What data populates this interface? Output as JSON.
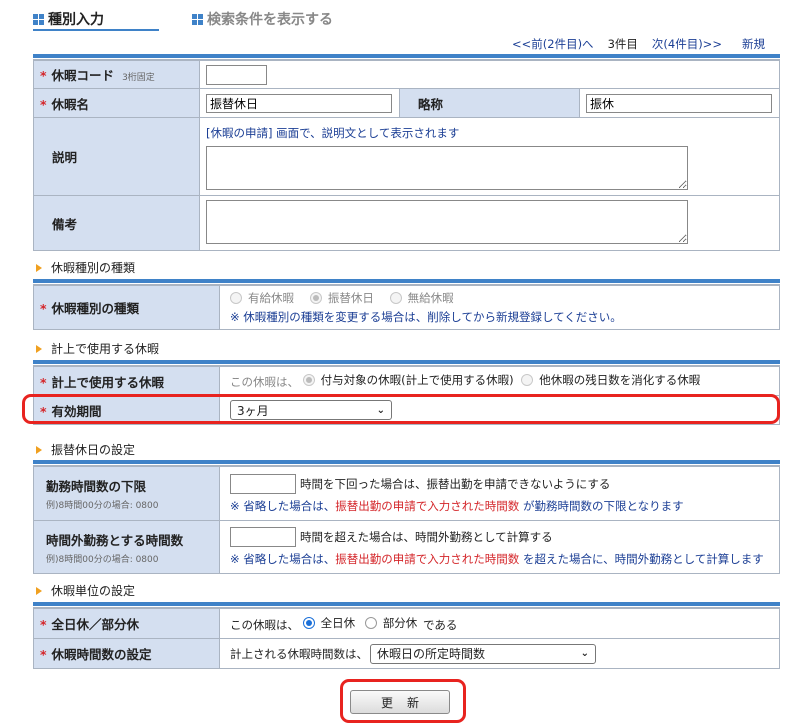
{
  "tabs": {
    "active": "種別入力",
    "inactive": "検索条件を表示する"
  },
  "pager": {
    "prev": "<<前(2件目)へ",
    "current": "3件目",
    "next": "次(4件目)>>",
    "new": "新規"
  },
  "fields": {
    "code": {
      "label": "休暇コード",
      "hint": "3桁固定",
      "value": ""
    },
    "name": {
      "label": "休暇名",
      "value": "振替休日"
    },
    "abbr": {
      "label": "略称",
      "value": "振休"
    },
    "desc": {
      "label": "説明",
      "note_link": "[休暇の申請]",
      "note_rest": "画面で、説明文として表示されます",
      "value": ""
    },
    "remarks": {
      "label": "備考",
      "value": ""
    }
  },
  "sections": {
    "kind": "休暇種別の種類",
    "plan": "計上で使用する休暇",
    "subst": "振替休日の設定",
    "unit": "休暇単位の設定"
  },
  "kind": {
    "label": "休暇種別の種類",
    "options": [
      "有給休暇",
      "振替休日",
      "無給休暇"
    ],
    "note": "※ 休暇種別の種類を変更する場合は、削除してから新規登録してください。"
  },
  "plan": {
    "label": "計上で使用する休暇",
    "prefix": "この休暇は、",
    "opt1": "付与対象の休暇(計上で使用する休暇)",
    "opt2": "他休暇の残日数を消化する休暇"
  },
  "validity": {
    "label": "有効期間",
    "value": "3ヶ月"
  },
  "subst": {
    "lower": {
      "label": "勤務時間数の下限",
      "example": "例)8時間00分の場合: 0800",
      "text": "時間を下回った場合は、振替出勤を申請できないようにする",
      "note_a": "※ 省略した場合は、",
      "note_red": "振替出勤の申請で入力された時間数",
      "note_b": "が勤務時間数の下限となります"
    },
    "overtime": {
      "label": "時間外勤務とする時間数",
      "example": "例)8時間00分の場合: 0800",
      "text": "時間を超えた場合は、時間外勤務として計算する",
      "note_a": "※ 省略した場合は、",
      "note_red": "振替出勤の申請で入力された時間数",
      "note_b": "を超えた場合に、時間外勤務として計算します"
    }
  },
  "unit": {
    "full": {
      "label": "全日休／部分休",
      "prefix": "この休暇は、",
      "opt1": "全日休",
      "opt2": "部分休",
      "suffix": "である"
    },
    "hours": {
      "label": "休暇時間数の設定",
      "prefix": "計上される休暇時間数は、",
      "value": "休暇日の所定時間数"
    }
  },
  "update_button": "更新",
  "colors": {
    "accent": "#3f82c8",
    "label_bg": "#d4dff0",
    "required": "#d4262a",
    "highlight": "#e8231f",
    "link": "#1c3f95"
  }
}
